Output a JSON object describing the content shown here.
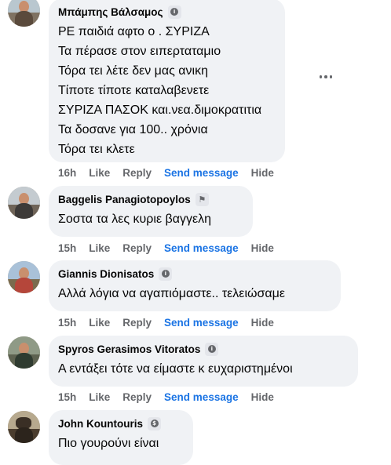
{
  "comments": [
    {
      "author": "Μπάμπης Βάλσαμος",
      "badge_icon": "info-badge-icon",
      "badge_glyph": "i",
      "lines": [
        "ΡΕ παιδιά αφτο ο . ΣΥΡΙΖΑ",
        "Τα πέρασε στον ειπερταταμιο",
        "Τόρα τει λέτε δεν μας ανικη",
        "Τίποτε τίποτε καταλαβενετε",
        "ΣΥΡΙΖΑ ΠΑΣΟΚ και.νεα.διμοκρατιτια",
        "Τα δοσανε για 100.. χρόνια",
        "Τόρα τει κλετε"
      ],
      "time": "16h"
    },
    {
      "author": "Baggelis Panagiotopoylos",
      "badge_icon": "flag-badge-icon",
      "badge_glyph": "⚑",
      "lines": [
        "Σοστα τα λες κυριε βαγγελη"
      ],
      "time": "15h"
    },
    {
      "author": "Giannis Dionisatos",
      "badge_icon": "info-badge-icon",
      "badge_glyph": "i",
      "lines": [
        "Αλλά λόγια να αγαπιόμαστε.. τελειώσαμε"
      ],
      "time": "15h"
    },
    {
      "author": "Spyros Gerasimos Vitoratos",
      "badge_icon": "info-badge-icon",
      "badge_glyph": "i",
      "lines": [
        "Α εντάξει τότε να είμαστε κ ευχαριστημένοι"
      ],
      "time": "15h"
    },
    {
      "author": "John Kountouris",
      "badge_icon": "dollar-badge-icon",
      "badge_glyph": "$",
      "lines": [
        "Πιο γουρούνι είναι"
      ],
      "time": ""
    }
  ],
  "actions": {
    "like": "Like",
    "reply": "Reply",
    "send_message": "Send message",
    "hide": "Hide"
  },
  "colors": {
    "bubble": "#f0f2f5",
    "action_text": "#65676b",
    "send_message": "#1b74e4"
  }
}
